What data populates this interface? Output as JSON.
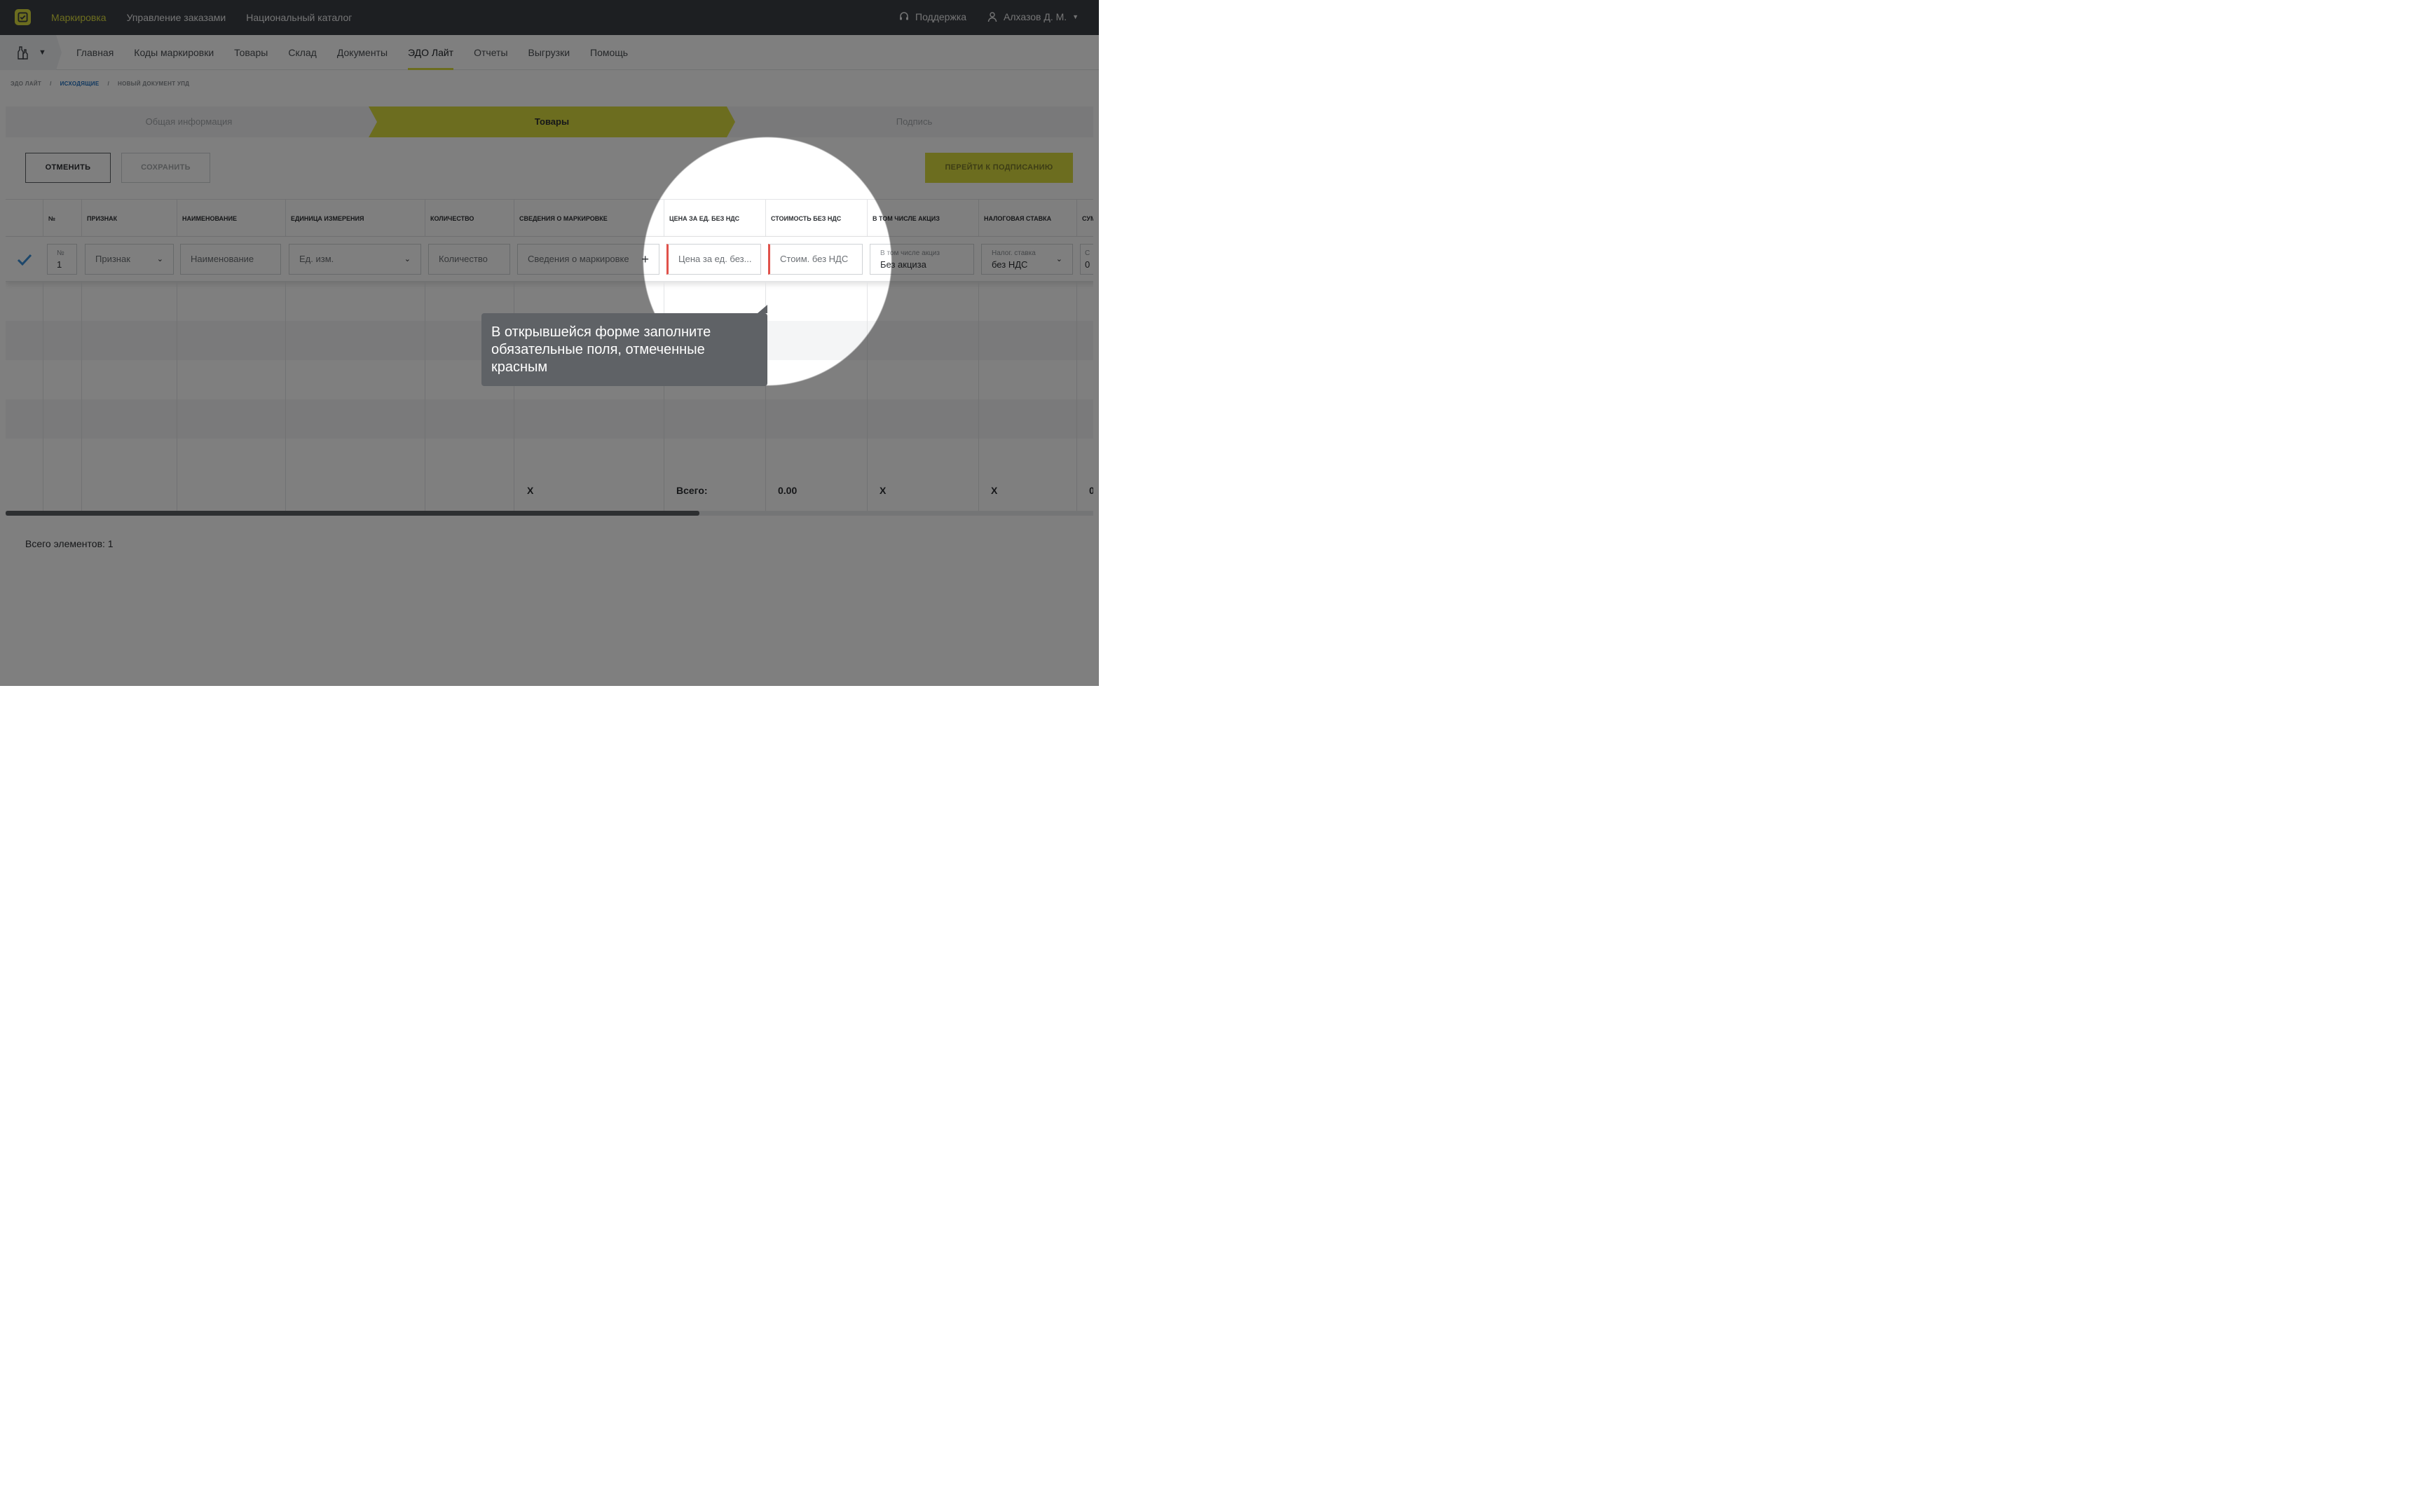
{
  "topbar": {
    "nav": [
      "Маркировка",
      "Управление заказами",
      "Национальный каталог"
    ],
    "support": "Поддержка",
    "user": "Алхазов Д. М."
  },
  "subnav": [
    "Главная",
    "Коды маркировки",
    "Товары",
    "Склад",
    "Документы",
    "ЭДО Лайт",
    "Отчеты",
    "Выгрузки",
    "Помощь"
  ],
  "breadcrumb": [
    "ЭДО ЛАЙТ",
    "ИСХОДЯЩИЕ",
    "НОВЫЙ ДОКУМЕНТ УПД"
  ],
  "steps": [
    "Общая информация",
    "Товары",
    "Подпись"
  ],
  "buttons": {
    "cancel": "ОТМЕНИТЬ",
    "save": "СОХРАНИТЬ",
    "sign": "ПЕРЕЙТИ К ПОДПИСАНИЮ"
  },
  "table": {
    "headers": [
      "№",
      "ПРИЗНАК",
      "НАИМЕНОВАНИЕ",
      "ЕДИНИЦА ИЗМЕРЕНИЯ",
      "КОЛИЧЕСТВО",
      "СВЕДЕНИЯ О МАРКИРОВКЕ",
      "ЦЕНА ЗА ЕД. БЕЗ НДС",
      "СТОИМОСТЬ БЕЗ НДС",
      "В ТОМ ЧИСЛЕ АКЦИЗ",
      "НАЛОГОВАЯ СТАВКА",
      "СУМ"
    ],
    "row": {
      "num_label": "№",
      "num_value": "1",
      "sign": "Признак",
      "name": "Наименование",
      "unit": "Ед. изм.",
      "quantity": "Количество",
      "marking": "Сведения о маркировке",
      "price": "Цена за ед. без...",
      "cost": "Стоим. без НДС",
      "excise_label": "В том числе акциз",
      "excise_value": "Без акциза",
      "tax_label": "Налог. ставка",
      "tax_value": "без НДС",
      "sum_label": "С",
      "sum_value": "0"
    },
    "totals": {
      "marking": "X",
      "label": "Всего:",
      "cost": "0.00",
      "excise": "X",
      "tax": "X",
      "sum": "0"
    }
  },
  "count": "Всего элементов: 1",
  "tooltip": "В открывшейся форме заполните обязательные поля, отмеченные красным",
  "colors": {
    "accent": "#d9da3f",
    "required": "#e0514a",
    "topbar": "#3b3f45"
  }
}
